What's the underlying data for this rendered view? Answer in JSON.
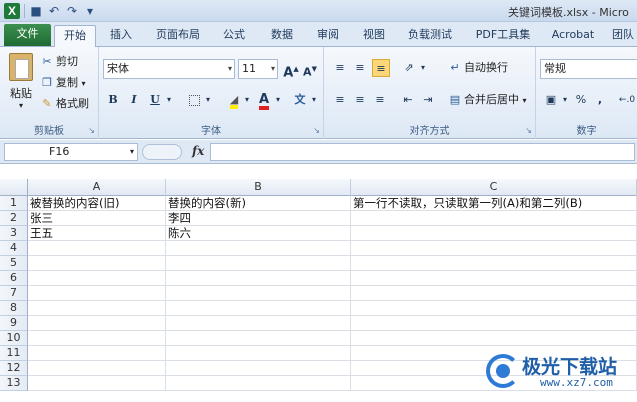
{
  "window": {
    "title": "关键词模板.xlsx - Micro"
  },
  "tabs": {
    "file": "文件",
    "items": [
      "开始",
      "插入",
      "页面布局",
      "公式",
      "数据",
      "审阅",
      "视图",
      "负载测试",
      "PDF工具集",
      "Acrobat",
      "团队"
    ]
  },
  "ribbon": {
    "clipboard": {
      "label": "剪贴板",
      "paste": "粘贴",
      "cut": "剪切",
      "copy": "复制",
      "format_painter": "格式刷"
    },
    "font": {
      "label": "字体",
      "font_name": "宋体",
      "font_size": "11",
      "bold": "B",
      "italic": "I",
      "underline": "U",
      "grow": "A",
      "shrink": "A",
      "font_color": "A",
      "phonetic": "文"
    },
    "alignment": {
      "label": "对齐方式",
      "wrap_text": "自动换行",
      "merge_center": "合并后居中"
    },
    "number": {
      "label": "数字",
      "format": "常规",
      "percent": "%",
      "comma": ","
    }
  },
  "formula_bar": {
    "name_box": "F16",
    "fx": "fx",
    "value": ""
  },
  "sheet": {
    "columns": [
      "A",
      "B",
      "C"
    ],
    "rows": [
      {
        "num": "1",
        "a": "被替换的内容(旧)",
        "b": "替换的内容(新)",
        "c": "第一行不读取，只读取第一列(A)和第二列(B)"
      },
      {
        "num": "2",
        "a": "张三",
        "b": "李四",
        "c": ""
      },
      {
        "num": "3",
        "a": "王五",
        "b": "陈六",
        "c": ""
      },
      {
        "num": "4",
        "a": "",
        "b": "",
        "c": ""
      },
      {
        "num": "5",
        "a": "",
        "b": "",
        "c": ""
      },
      {
        "num": "6",
        "a": "",
        "b": "",
        "c": ""
      },
      {
        "num": "7",
        "a": "",
        "b": "",
        "c": ""
      },
      {
        "num": "8",
        "a": "",
        "b": "",
        "c": ""
      },
      {
        "num": "9",
        "a": "",
        "b": "",
        "c": ""
      },
      {
        "num": "10",
        "a": "",
        "b": "",
        "c": ""
      },
      {
        "num": "11",
        "a": "",
        "b": "",
        "c": ""
      },
      {
        "num": "12",
        "a": "",
        "b": "",
        "c": ""
      },
      {
        "num": "13",
        "a": "",
        "b": "",
        "c": ""
      }
    ]
  },
  "watermark": {
    "brand": "极光下载站",
    "url": "www.xz7.com"
  }
}
